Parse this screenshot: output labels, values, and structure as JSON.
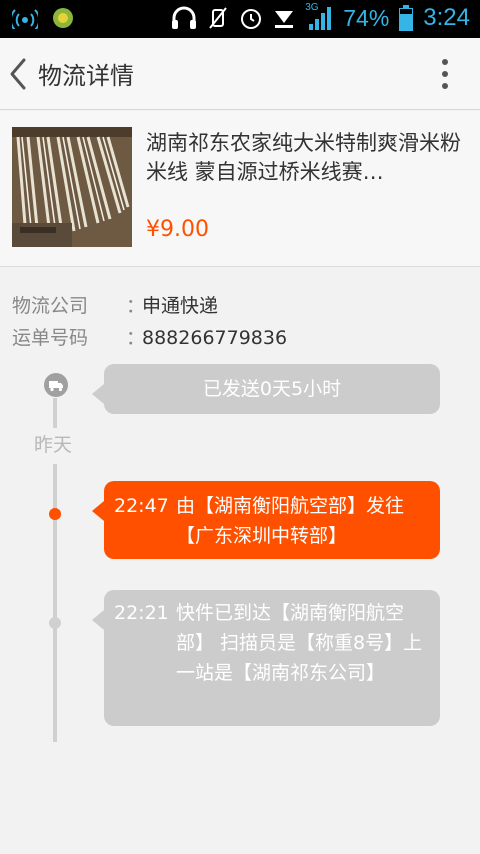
{
  "status_bar": {
    "network": "3G",
    "battery_percent": "74%",
    "time": "3:24",
    "icons": [
      "wifi-signal-icon",
      "app-notification-icon",
      "headset-icon",
      "mute-icon",
      "alarm-icon",
      "download-icon",
      "signal-icon",
      "battery-icon"
    ]
  },
  "header": {
    "title": "物流详情",
    "back_icon": "chevron-left-icon",
    "more_icon": "more-vertical-icon"
  },
  "product": {
    "name": "湖南祁东农家纯大米特制爽滑米粉 米线 蒙自源过桥米线赛…",
    "price": "¥9.00",
    "image": "rice-noodle-drying-photo"
  },
  "shipping": {
    "company_label": "物流公司",
    "company": "申通快递",
    "tracking_label": "运单号码",
    "tracking": "888266779836",
    "colon": "："
  },
  "timeline": {
    "summary": "已发送0天5小时",
    "day_label": "昨天",
    "events": [
      {
        "time": "22:47",
        "desc": "由【湖南衡阳航空部】发往【广东深圳中转部】",
        "status": "latest"
      },
      {
        "time": "22:21",
        "desc": "快件已到达【湖南衡阳航空部】 扫描员是【称重8号】上一站是【湖南祁东公司】",
        "status": "past"
      }
    ]
  },
  "colors": {
    "accent": "#ff5000",
    "status_blue": "#35b4e6",
    "bubble_gray": "#cccccc"
  }
}
